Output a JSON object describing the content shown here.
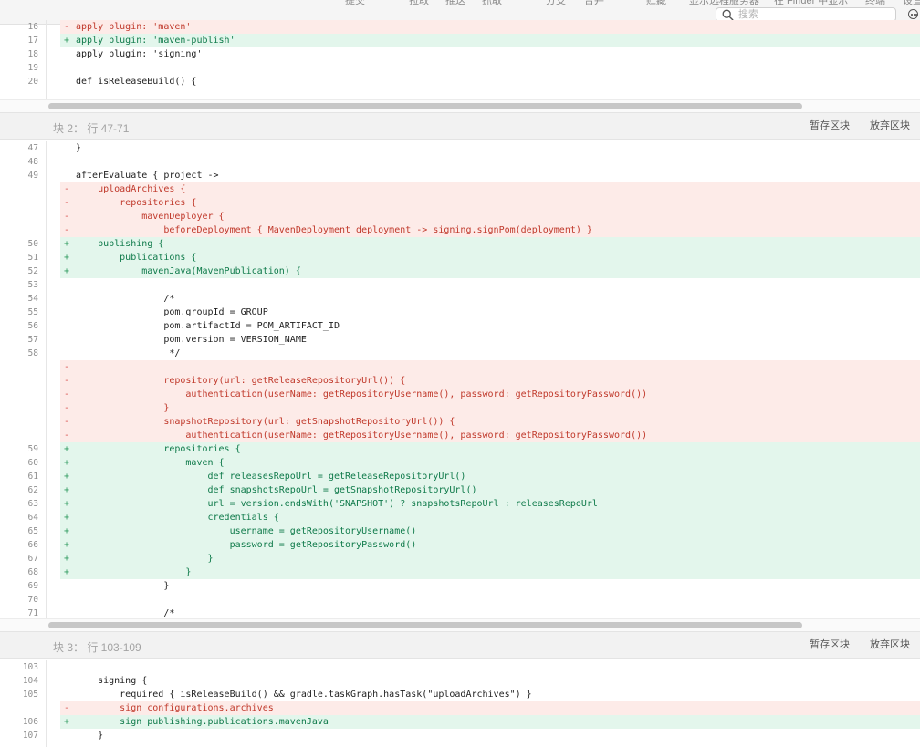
{
  "toolbar": {
    "labels": [
      "提交",
      "拉取",
      "推送",
      "抓取",
      "分支",
      "合并",
      "贮藏",
      "显示远程服务器",
      "在 Finder 中显示",
      "终端",
      "设置"
    ],
    "search_placeholder": "搜索"
  },
  "hunk_1": {
    "lines": [
      {
        "n": "16",
        "t": "del",
        "c": "apply plugin: 'maven'"
      },
      {
        "n": "17",
        "t": "add",
        "c": "apply plugin: 'maven-publish'"
      },
      {
        "n": "18",
        "t": "ctx",
        "c": "apply plugin: 'signing'"
      },
      {
        "n": "19",
        "t": "ctx",
        "c": ""
      },
      {
        "n": "20",
        "t": "ctx",
        "c": "def isReleaseBuild() {"
      }
    ]
  },
  "hunk_2": {
    "title": "块 2： 行 47-71",
    "stage_label": "暂存区块",
    "discard_label": "放弃区块",
    "lines": [
      {
        "n": "47",
        "t": "ctx",
        "c": "}"
      },
      {
        "n": "48",
        "t": "ctx",
        "c": ""
      },
      {
        "n": "49",
        "t": "ctx",
        "c": "afterEvaluate { project ->"
      },
      {
        "n": "",
        "t": "del",
        "c": "    uploadArchives {"
      },
      {
        "n": "",
        "t": "del",
        "c": "        repositories {"
      },
      {
        "n": "",
        "t": "del",
        "c": "            mavenDeployer {"
      },
      {
        "n": "",
        "t": "del",
        "c": "                beforeDeployment { MavenDeployment deployment -> signing.signPom(deployment) }"
      },
      {
        "n": "50",
        "t": "add",
        "c": "    publishing {"
      },
      {
        "n": "51",
        "t": "add",
        "c": "        publications {"
      },
      {
        "n": "52",
        "t": "add",
        "c": "            mavenJava(MavenPublication) {"
      },
      {
        "n": "53",
        "t": "ctx",
        "c": ""
      },
      {
        "n": "54",
        "t": "ctx",
        "c": "                /*"
      },
      {
        "n": "55",
        "t": "ctx",
        "c": "                pom.groupId = GROUP"
      },
      {
        "n": "56",
        "t": "ctx",
        "c": "                pom.artifactId = POM_ARTIFACT_ID"
      },
      {
        "n": "57",
        "t": "ctx",
        "c": "                pom.version = VERSION_NAME"
      },
      {
        "n": "58",
        "t": "ctx",
        "c": "                 */"
      },
      {
        "n": "",
        "t": "del",
        "c": ""
      },
      {
        "n": "",
        "t": "del",
        "c": "                repository(url: getReleaseRepositoryUrl()) {"
      },
      {
        "n": "",
        "t": "del",
        "c": "                    authentication(userName: getRepositoryUsername(), password: getRepositoryPassword())"
      },
      {
        "n": "",
        "t": "del",
        "c": "                }"
      },
      {
        "n": "",
        "t": "del",
        "c": "                snapshotRepository(url: getSnapshotRepositoryUrl()) {"
      },
      {
        "n": "",
        "t": "del",
        "c": "                    authentication(userName: getRepositoryUsername(), password: getRepositoryPassword())"
      },
      {
        "n": "59",
        "t": "add",
        "c": "                repositories {"
      },
      {
        "n": "60",
        "t": "add",
        "c": "                    maven {"
      },
      {
        "n": "61",
        "t": "add",
        "c": "                        def releasesRepoUrl = getReleaseRepositoryUrl()"
      },
      {
        "n": "62",
        "t": "add",
        "c": "                        def snapshotsRepoUrl = getSnapshotRepositoryUrl()"
      },
      {
        "n": "63",
        "t": "add",
        "c": "                        url = version.endsWith('SNAPSHOT') ? snapshotsRepoUrl : releasesRepoUrl"
      },
      {
        "n": "64",
        "t": "add",
        "c": "                        credentials {"
      },
      {
        "n": "65",
        "t": "add",
        "c": "                            username = getRepositoryUsername()"
      },
      {
        "n": "66",
        "t": "add",
        "c": "                            password = getRepositoryPassword()"
      },
      {
        "n": "67",
        "t": "add",
        "c": "                        }"
      },
      {
        "n": "68",
        "t": "add",
        "c": "                    }"
      },
      {
        "n": "69",
        "t": "ctx",
        "c": "                }"
      },
      {
        "n": "70",
        "t": "ctx",
        "c": ""
      },
      {
        "n": "71",
        "t": "ctx",
        "c": "                /*"
      }
    ]
  },
  "hunk_3": {
    "title": "块 3： 行 103-109",
    "stage_label": "暂存区块",
    "discard_label": "放弃区块",
    "lines": [
      {
        "n": "103",
        "t": "ctx",
        "c": ""
      },
      {
        "n": "104",
        "t": "ctx",
        "c": "    signing {"
      },
      {
        "n": "105",
        "t": "ctx",
        "c": "        required { isReleaseBuild() && gradle.taskGraph.hasTask(\"uploadArchives\") }"
      },
      {
        "n": "",
        "t": "del",
        "c": "        sign configurations.archives"
      },
      {
        "n": "106",
        "t": "add",
        "c": "        sign publishing.publications.mavenJava"
      },
      {
        "n": "107",
        "t": "ctx",
        "c": "    }"
      }
    ]
  }
}
